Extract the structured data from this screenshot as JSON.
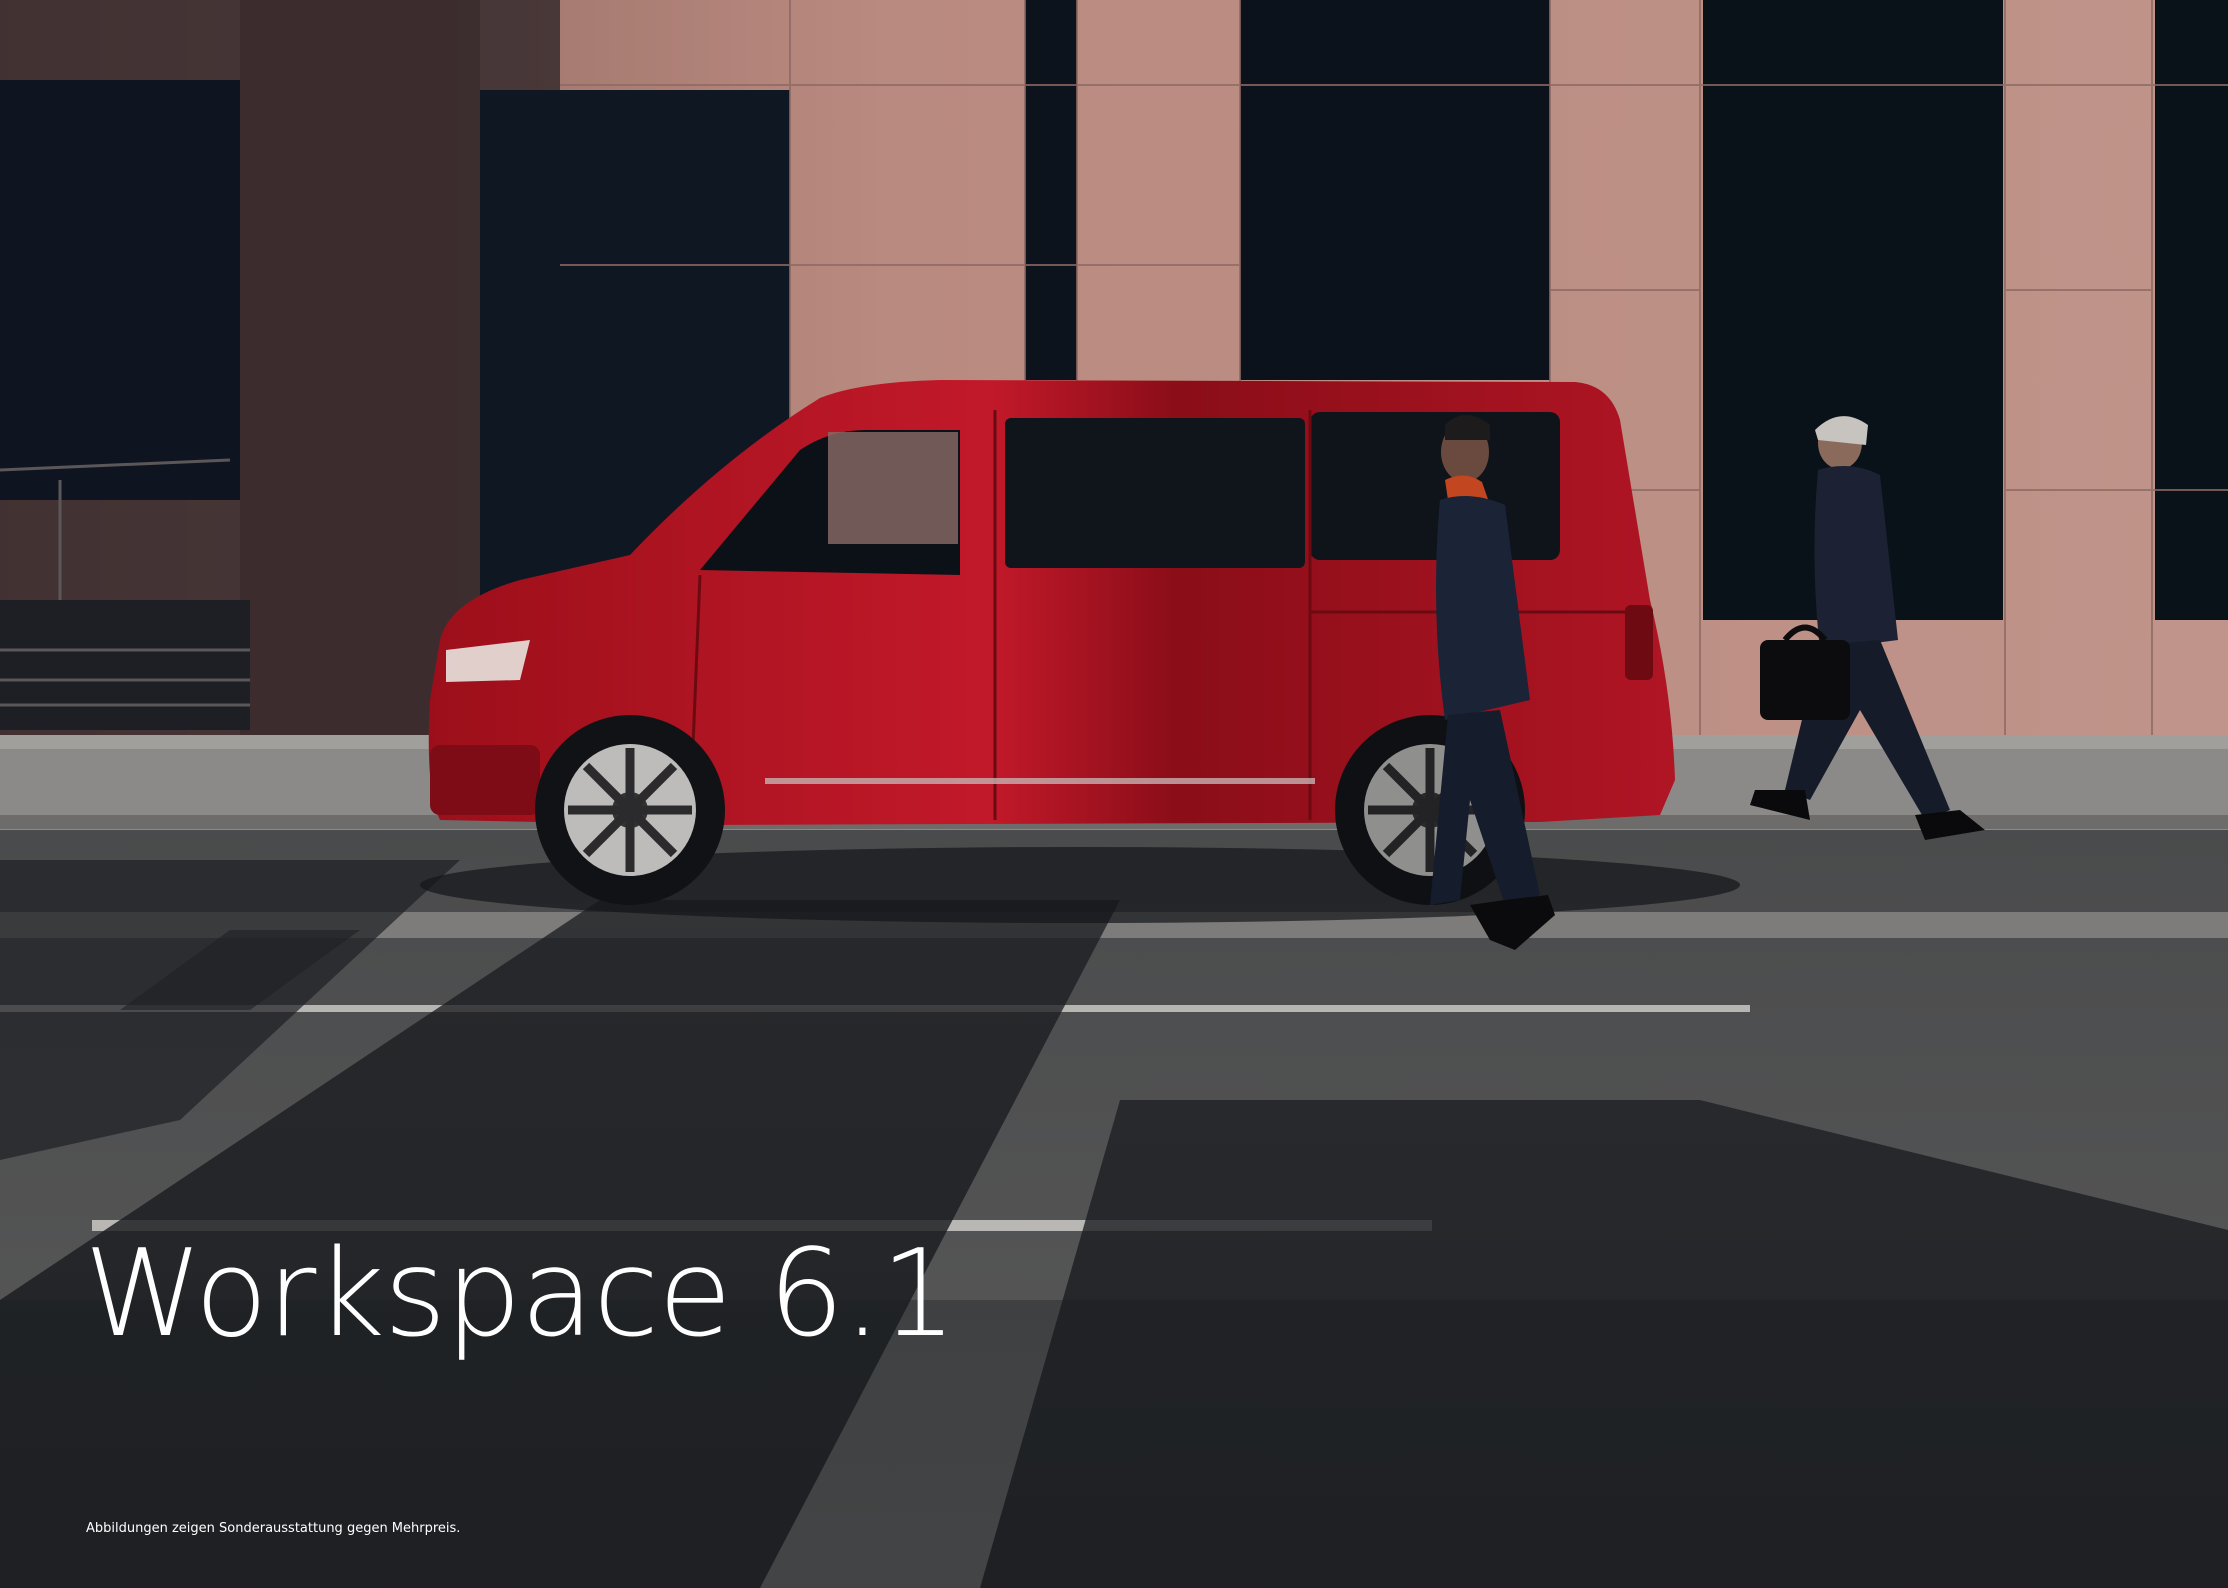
{
  "headline": "Workspace 6.1",
  "disclaimer": "Abbildungen zeigen Sonderausstattung gegen Mehrpreis.",
  "colors": {
    "facade": "#b8877e",
    "window": "#0d1620",
    "van_body": "#b4141f",
    "road": "#3a3c3e",
    "text": "#ffffff"
  }
}
